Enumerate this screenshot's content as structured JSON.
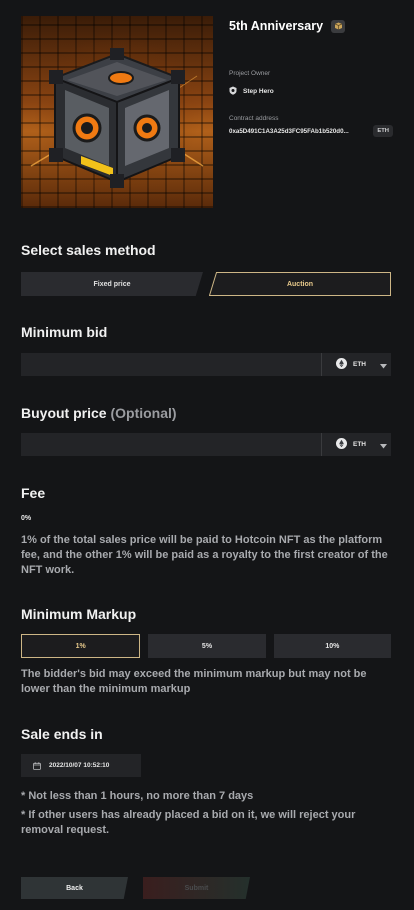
{
  "nft": {
    "title": "5th Anniversary",
    "owner_label": "Project Owner",
    "owner_name": "Step Hero",
    "contract_label": "Contract address",
    "contract_address": "0xa5D491C1A3A25d3FC95FAb1b520d0...",
    "chain_badge": "ETH"
  },
  "sales_method": {
    "heading": "Select sales method",
    "tabs": [
      {
        "label": "Fixed price",
        "selected": false
      },
      {
        "label": "Auction",
        "selected": true
      }
    ]
  },
  "minimum_bid": {
    "heading": "Minimum bid",
    "value": "",
    "currency": "ETH"
  },
  "buyout_price": {
    "heading": "Buyout price",
    "optional": "(Optional)",
    "value": "",
    "currency": "ETH"
  },
  "fee": {
    "heading": "Fee",
    "value": "0%",
    "description": "1% of the total sales price will be paid to Hotcoin NFT as the platform fee, and the other 1% will be paid as a royalty to the first creator of the NFT work."
  },
  "minimum_markup": {
    "heading": "Minimum Markup",
    "options": [
      {
        "label": "1%",
        "selected": true
      },
      {
        "label": "5%",
        "selected": false
      },
      {
        "label": "10%",
        "selected": false
      }
    ],
    "note": "The bidder's bid may exceed the minimum markup but may not be lower than the minimum markup"
  },
  "sale_ends": {
    "heading": "Sale ends in",
    "datetime": "2022/10/07 10:52:10",
    "rule_1": "* Not less than 1 hours, no more than 7 days",
    "rule_2": "* If other users has already placed a bid on it, we will reject your removal request."
  },
  "actions": {
    "back": "Back",
    "submit": "Submit"
  },
  "colors": {
    "background": "#141517",
    "accent_gold": "#e7c98b",
    "panel": "#232427"
  }
}
